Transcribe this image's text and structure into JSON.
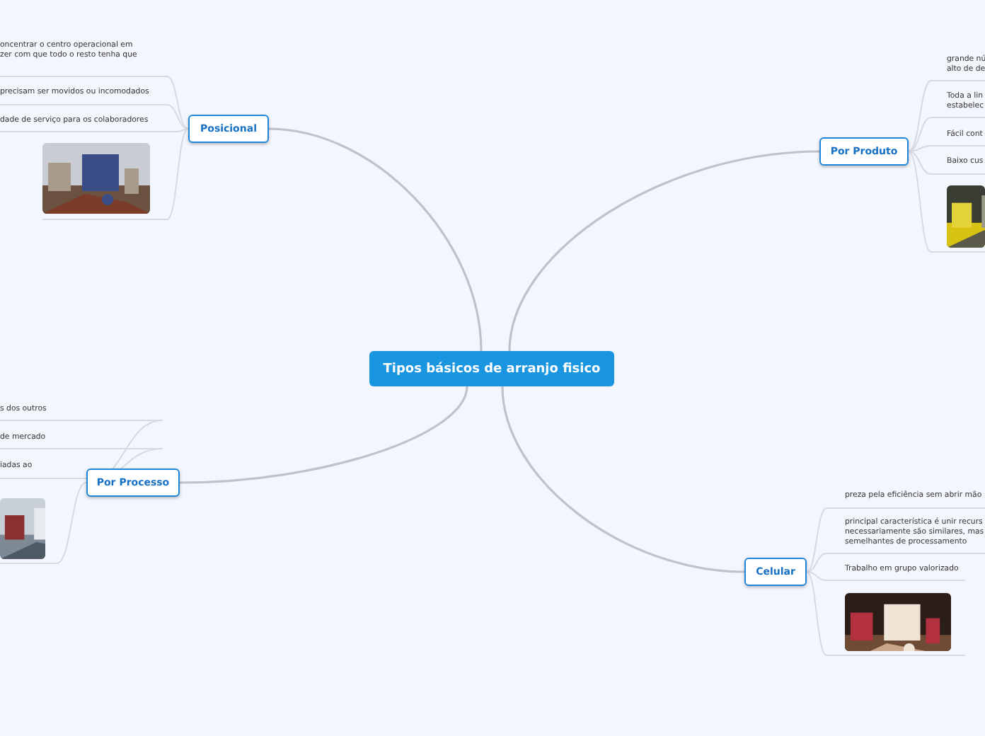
{
  "central_topic": "Tipos básicos de arranjo fisico",
  "branches": [
    {
      "title": "Posicional",
      "leaves": [
        {
          "kind": "text",
          "lines": [
            "oncentrar o centro operacional em",
            "zer com que todo o resto tenha que"
          ]
        },
        {
          "kind": "text",
          "lines": [
            "precisam ser movidos ou incomodados"
          ]
        },
        {
          "kind": "text",
          "lines": [
            "dade de serviço para os colaboradores"
          ]
        },
        {
          "kind": "picture"
        }
      ]
    },
    {
      "title": "Por Produto",
      "leaves": [
        {
          "kind": "text",
          "lines": [
            "grande nú",
            "alto de de"
          ]
        },
        {
          "kind": "text",
          "lines": [
            "Toda a lin",
            "estabelec"
          ]
        },
        {
          "kind": "text",
          "lines": [
            "Fácil cont"
          ]
        },
        {
          "kind": "text",
          "lines": [
            "Baixo cus"
          ]
        },
        {
          "kind": "picture"
        }
      ]
    },
    {
      "title": "Por Processo",
      "leaves": [
        {
          "kind": "text",
          "lines": [
            "s dos outros"
          ]
        },
        {
          "kind": "text",
          "lines": [
            "de mercado"
          ]
        },
        {
          "kind": "text",
          "lines": [
            "iadas ao"
          ]
        },
        {
          "kind": "picture"
        }
      ]
    },
    {
      "title": "Celular",
      "leaves": [
        {
          "kind": "text",
          "lines": [
            "preza pela eficiência sem abrir mão"
          ]
        },
        {
          "kind": "text",
          "lines": [
            "principal característica é unir recurs",
            "necessariamente são similares, mas",
            "semelhantes de processamento"
          ]
        },
        {
          "kind": "text",
          "lines": [
            "Trabalho em grupo valorizado"
          ]
        },
        {
          "kind": "picture"
        }
      ]
    }
  ]
}
